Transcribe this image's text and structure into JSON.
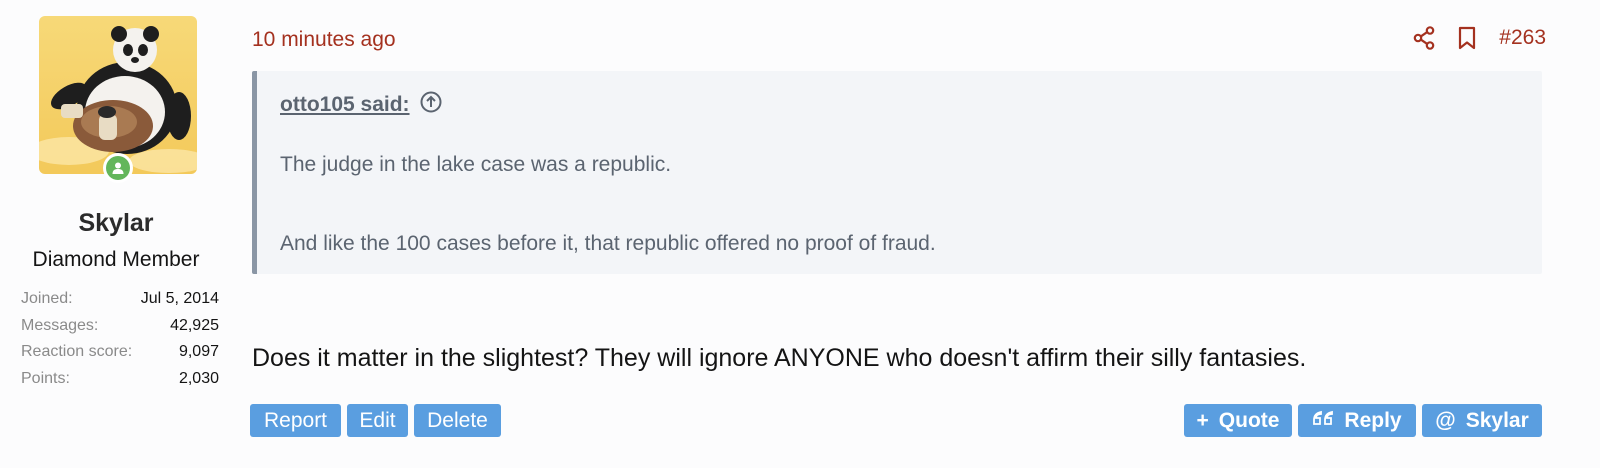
{
  "user": {
    "name": "Skylar",
    "title": "Diamond Member",
    "stats": [
      {
        "label": "Joined:",
        "value": "Jul 5, 2014"
      },
      {
        "label": "Messages:",
        "value": "42,925"
      },
      {
        "label": "Reaction score:",
        "value": "9,097"
      },
      {
        "label": "Points:",
        "value": "2,030"
      }
    ]
  },
  "post": {
    "time": "10 minutes ago",
    "number": "#263",
    "quote": {
      "author_label": "otto105 said:",
      "lines": [
        "The judge in the lake case was a republic.",
        "And like the 100 cases before it, that republic offered no proof of fraud."
      ]
    },
    "body": "Does it matter in the slightest? They will ignore ANYONE who doesn't affirm their silly fantasies."
  },
  "buttons": {
    "report": "Report",
    "edit": "Edit",
    "delete": "Delete",
    "quote": "Quote",
    "reply": "Reply",
    "mention": "Skylar",
    "quote_icon": "+",
    "mention_icon": "@"
  },
  "colors": {
    "accent": "#a4311f",
    "button": "#5a9ee0",
    "online": "#63b65b",
    "quote_bar": "#8a96a5"
  }
}
